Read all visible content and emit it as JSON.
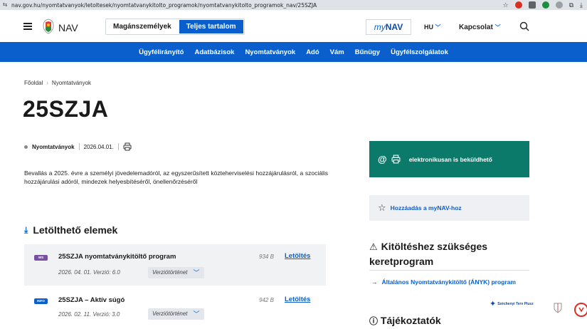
{
  "browser": {
    "url": "nav.gov.hu/nyomtatvanyok/letoltesek/nyomtatvanykitolto_programok/nyomtatvanykitolto_programok_nav/25SZJA"
  },
  "header": {
    "logo_text": "NAV",
    "toggle": [
      "Magánszemélyek",
      "Teljes tartalom"
    ],
    "mynav_prefix": "my",
    "mynav_suffix": "NAV",
    "lang": "HU",
    "contact": "Kapcsolat"
  },
  "nav": {
    "items": [
      "Ügyfélirányító",
      "Adatbázisok",
      "Nyomtatványok",
      "Adó",
      "Vám",
      "Bűnügy",
      "Ügyfélszolgálatok"
    ]
  },
  "breadcrumb": [
    "Főoldal",
    "Nyomtatványok"
  ],
  "page_title": "25SZJA",
  "meta": {
    "tag": "Nyomtatványok",
    "date": "2026.04.01."
  },
  "description": "Bevallás a 2025. évre a személyi jövedelemadóról, az egyszerűsített közteherviselési hozzájárulásról, a szociális hozzájárulási adóról, mindezek helyesbítéséről, önellenőrzéséről",
  "downloads": {
    "heading": "Letölthető elemek",
    "items": [
      {
        "badge": "WS",
        "name": "25SZJA nyomtatványkitöltő program",
        "sub": "2026. 04. 01. Verzió: 6.0",
        "history": "Verziótörténet",
        "size": "934 B",
        "link": "Letöltés"
      },
      {
        "badge": "INFO",
        "name": "25SZJA – Aktív súgó",
        "sub": "2026. 02. 11. Verzió: 3.0",
        "history": "Verziótörténet",
        "size": "942 B",
        "link": "Letöltés"
      }
    ]
  },
  "sidebar": {
    "electronic": "elektronikusan is beküldhető",
    "add_mynav": "Hozzáadás a myNAV-hoz",
    "required_heading": "Kitöltéshez szükséges keretprogram",
    "required_link": "Általános Nyomtatványkitöltő (ÁNYK) program",
    "next_heading": "Tájékoztatók"
  },
  "footer": {
    "szechenyi": "Széchenyi Terv Plusz"
  },
  "colors": {
    "brand_blue": "#0a5fcc",
    "teal": "#0c7a6a",
    "badge_purple": "#7a4ea3"
  }
}
